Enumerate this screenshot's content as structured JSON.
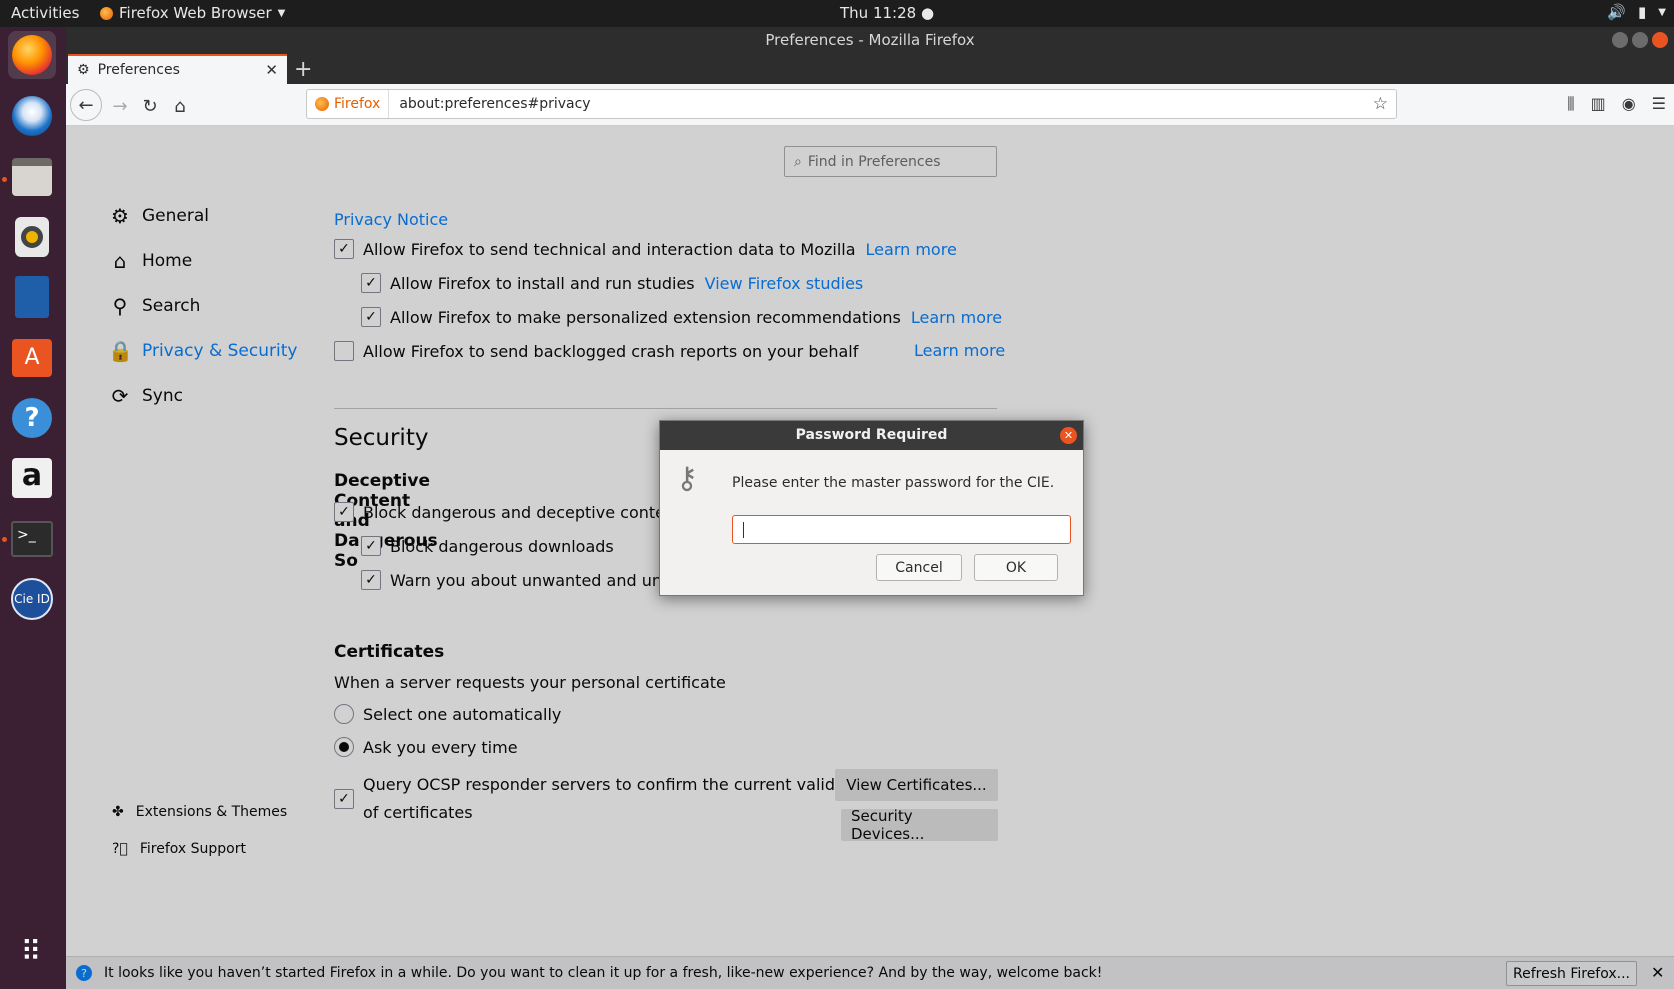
{
  "topbar": {
    "activities": "Activities",
    "app_menu": "Firefox Web Browser",
    "clock": "Thu 11:28"
  },
  "dock": {
    "items": [
      "firefox-icon",
      "thunderbird-icon",
      "files-icon",
      "rhythmbox-icon",
      "writer-icon",
      "software-icon",
      "help-icon",
      "amazon-icon",
      "terminal-icon",
      "cie-id-icon",
      "show-apps-icon"
    ],
    "cie_label": "Cie ID"
  },
  "window": {
    "title": "Preferences - Mozilla Firefox",
    "tab_label": "Preferences"
  },
  "navbar": {
    "identity": "Firefox",
    "url": "about:preferences#privacy"
  },
  "search": {
    "placeholder": "Find in Preferences"
  },
  "sidebar": {
    "items": [
      {
        "label": "General",
        "icon": "gear-icon"
      },
      {
        "label": "Home",
        "icon": "home-icon"
      },
      {
        "label": "Search",
        "icon": "search-icon"
      },
      {
        "label": "Privacy & Security",
        "icon": "lock-icon"
      },
      {
        "label": "Sync",
        "icon": "sync-icon"
      }
    ],
    "footer": {
      "extensions": "Extensions & Themes",
      "support": "Firefox Support"
    }
  },
  "data_collection": {
    "privacy_notice": "Privacy Notice",
    "telemetry": "Allow Firefox to send technical and interaction data to Mozilla",
    "telemetry_learn": "Learn more",
    "studies": "Allow Firefox to install and run studies",
    "studies_link": "View Firefox studies",
    "recommendations": "Allow Firefox to make personalized extension recommendations",
    "recommendations_learn": "Learn more",
    "crash_reports": "Allow Firefox to send backlogged crash reports on your behalf",
    "crash_learn": "Learn more"
  },
  "security": {
    "heading": "Security",
    "deceptive_heading": "Deceptive Content and Dangerous So",
    "block_deceptive": "Block dangerous and deceptive content",
    "block_downloads": "Block dangerous downloads",
    "warn_unwanted": "Warn you about unwanted and uncommon software"
  },
  "certificates": {
    "heading": "Certificates",
    "prompt": "When a server requests your personal certificate",
    "select_auto": "Select one automatically",
    "ask_every": "Ask you every time",
    "ocsp_line1": "Query OCSP responder servers to confirm the current validity",
    "ocsp_line2": "of certificates",
    "view_certs": "View Certificates...",
    "security_devices": "Security Devices..."
  },
  "notification": {
    "text": "It looks like you haven’t started Firefox in a while. Do you want to clean it up for a fresh, like-new experience? And by the way, welcome back!",
    "button": "Refresh Firefox..."
  },
  "dialog": {
    "title": "Password Required",
    "message": "Please enter the master password for the CIE.",
    "password_value": "",
    "cancel": "Cancel",
    "ok": "OK"
  },
  "colors": {
    "accent": "#0a84ff",
    "ubuntu_orange": "#e95420",
    "dock_bg": "#3b2033"
  }
}
